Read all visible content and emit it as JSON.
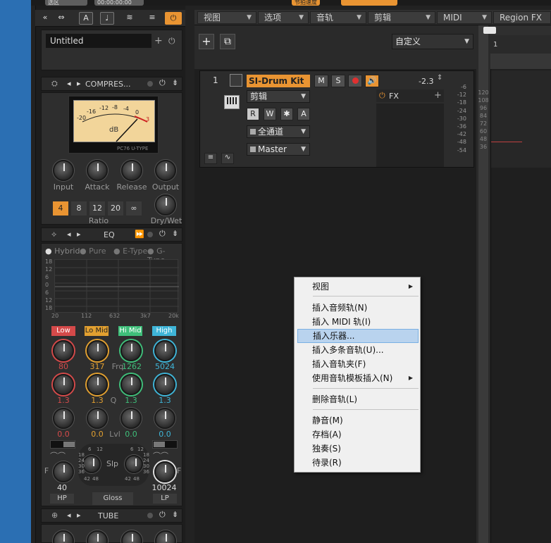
{
  "top_cut": {
    "left_label": "选区",
    "time": "00:00:00:00",
    "center": "节拍速度"
  },
  "inspector": {
    "toolbar": {
      "arrows": "«",
      "icons": [
        "⇔",
        "A",
        "♩",
        "≋",
        "≡",
        "⏻"
      ]
    },
    "preset_name": "Untitled",
    "compressor": {
      "title": "COMPRES...",
      "meter_scale": [
        "-20",
        "-16",
        "-12",
        "-8",
        "-4",
        "0",
        "3"
      ],
      "meter_unit": "dB",
      "meter_brand": "PC76 U-TYPE",
      "knobs": [
        "Input",
        "Attack",
        "Release",
        "Output"
      ],
      "ratio_buttons": [
        "4",
        "8",
        "12",
        "20",
        "∞"
      ],
      "ratio_label": "Ratio",
      "drywet_label": "Dry/Wet"
    },
    "eq": {
      "title": "EQ",
      "modes": [
        "Hybrid",
        "Pure",
        "E-Type",
        "G-Type"
      ],
      "y_labels": [
        "18",
        "12",
        "6",
        "0",
        "6",
        "12",
        "18"
      ],
      "x_labels": [
        "20",
        "112",
        "632",
        "3k7",
        "20k"
      ],
      "bands": [
        {
          "name": "Low",
          "color": "#d54a4a",
          "freq": "80",
          "q": "1.3",
          "gain": "0.0"
        },
        {
          "name": "Lo Mid",
          "color": "#e2a030",
          "freq": "317",
          "q": "1.3",
          "gain": "0.0"
        },
        {
          "name": "Hi Mid",
          "color": "#3fbf7a",
          "freq": "1262",
          "q": "1.3",
          "gain": "0.0"
        },
        {
          "name": "High",
          "color": "#3fb5d8",
          "freq": "5024",
          "q": "1.3",
          "gain": "0.0"
        }
      ],
      "row_labels": [
        "Frq",
        "Q",
        "Lvl"
      ],
      "slope_label": "Slp",
      "slope_ticks_left": [
        "6",
        "12",
        "18",
        "24",
        "30",
        "36",
        "42",
        "48"
      ],
      "slope_ticks_right": [
        "6",
        "12",
        "18",
        "24",
        "30",
        "36",
        "42",
        "48"
      ],
      "hp_value": "40",
      "lp_value": "10024",
      "hp_label": "HP",
      "lp_label": "LP",
      "gloss_label": "Gloss",
      "f_label": "F"
    },
    "tube": {
      "title": "TUBE"
    }
  },
  "menubar": {
    "items": [
      "视图",
      "选项",
      "音轨",
      "剪辑",
      "MIDI",
      "Region FX"
    ]
  },
  "track_header": {
    "preset": "自定义"
  },
  "track": {
    "number": "1",
    "name": "SI-Drum Kit 1",
    "mute": "M",
    "solo": "S",
    "volume": "-2.3",
    "clip_dropdown": "剪辑",
    "rwa": [
      "R",
      "W",
      "✱",
      "A"
    ],
    "input_dropdown": "全通道",
    "output_dropdown": "Master",
    "fx_label": "FX",
    "meter_scale": [
      "-6",
      "-12",
      "-18",
      "-24",
      "-30",
      "-36",
      "-42",
      "-48",
      "-54"
    ]
  },
  "timeline": {
    "marker": "1",
    "scale": [
      "120",
      "108",
      "96",
      "84",
      "72",
      "60",
      "48",
      "36"
    ]
  },
  "context_menu": {
    "items": [
      {
        "label": "视图",
        "submenu": true
      },
      {
        "sep": true
      },
      {
        "label": "插入音频轨(N)"
      },
      {
        "label": "插入 MIDI 轨(I)"
      },
      {
        "label": "插入乐器...",
        "highlight": true
      },
      {
        "label": "插入多条音轨(U)..."
      },
      {
        "label": "插入音轨夹(F)"
      },
      {
        "label": "使用音轨模板插入(N)",
        "submenu": true
      },
      {
        "sep": true
      },
      {
        "label": "删除音轨(L)"
      },
      {
        "sep": true
      },
      {
        "label": "静音(M)"
      },
      {
        "label": "存档(A)"
      },
      {
        "label": "独奏(S)"
      },
      {
        "label": "待录(R)"
      }
    ]
  }
}
